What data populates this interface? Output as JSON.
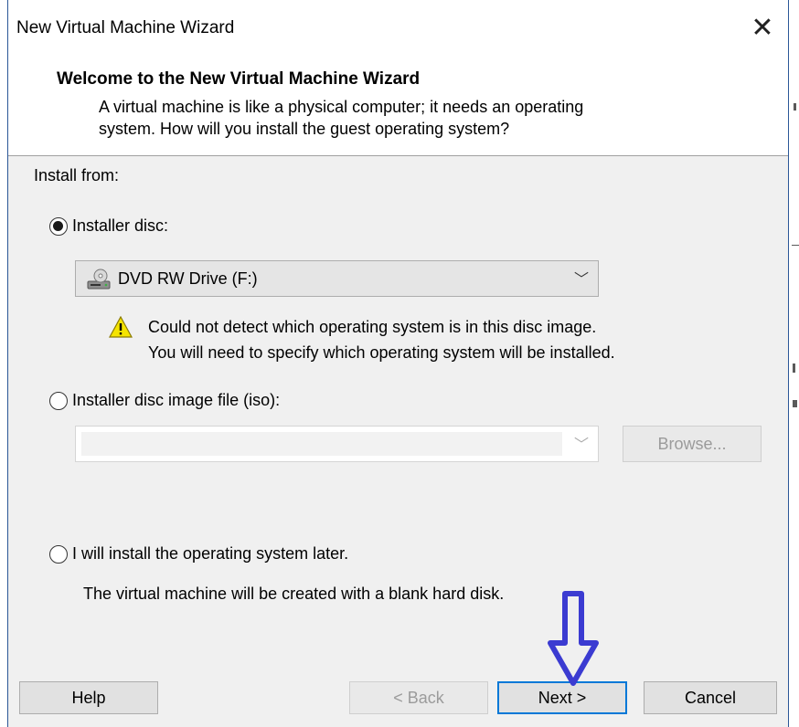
{
  "window": {
    "title": "New Virtual Machine Wizard",
    "close_glyph": "✕"
  },
  "header": {
    "title": "Welcome to the New Virtual Machine Wizard",
    "subtitle_line1": "A virtual machine is like a physical computer; it needs an operating",
    "subtitle_line2": "system. How will you install the guest operating system?"
  },
  "install_from_label": "Install from:",
  "options": {
    "installer_disc": {
      "label": "Installer disc:",
      "selected": true
    },
    "disc_image": {
      "label": "Installer disc image file (iso):",
      "selected": false
    },
    "later": {
      "label": "I will install the operating system later.",
      "selected": false
    }
  },
  "drive_combo": {
    "value": "DVD RW Drive (F:)",
    "arrow": "﹀",
    "icon": "dvd-drive-icon"
  },
  "warning": {
    "icon": "warning-icon",
    "line1": "Could not detect which operating system is in this disc image.",
    "line2": "You will need to specify which operating system will be installed."
  },
  "iso_combo": {
    "value": "",
    "arrow": "﹀"
  },
  "browse_button": "Browse...",
  "later_description": "The virtual machine will be created with a blank hard disk.",
  "buttons": {
    "help": "Help",
    "back": "< Back",
    "next": "Next >",
    "cancel": "Cancel"
  },
  "colors": {
    "arrow_annotation": "#3b3bd1",
    "focus_border": "#0078d7",
    "window_border": "#2b5797"
  }
}
